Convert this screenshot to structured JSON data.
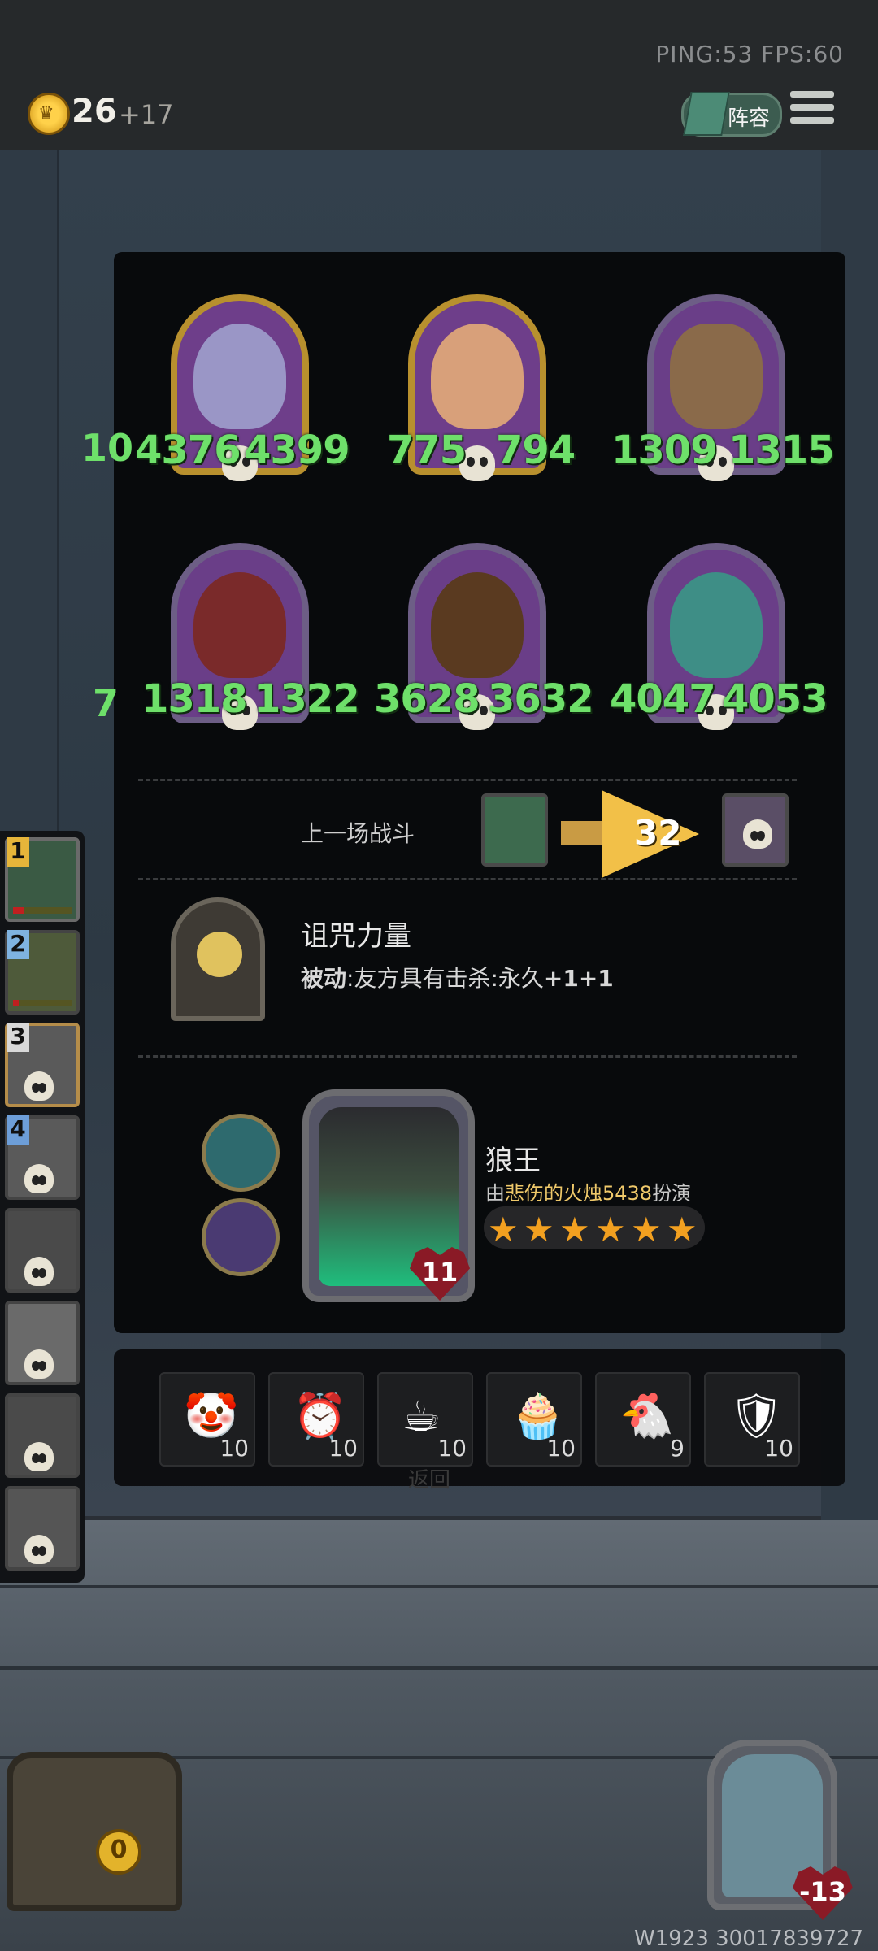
{
  "topbar": {
    "ping_fps": "PING:53   FPS:60",
    "gold": "26",
    "gold_income": "+17",
    "lineup_label": "阵容"
  },
  "board": {
    "row1": [
      {
        "attack": "4376",
        "health": "4399",
        "name": "wizard-portrait"
      },
      {
        "attack": "775",
        "health": "794",
        "name": "cyborg-portrait"
      },
      {
        "attack": "1309",
        "health": "1315",
        "name": "robot-portrait"
      }
    ],
    "row2": [
      {
        "attack": "1318",
        "health": "1322",
        "name": "assassin-portrait"
      },
      {
        "attack": "3628",
        "health": "3632",
        "name": "hooded-portrait"
      },
      {
        "attack": "4047",
        "health": "4053",
        "name": "spirit-portrait"
      }
    ],
    "side_left_1": "10",
    "side_left_2": "7"
  },
  "last_battle": {
    "label": "上一场战斗",
    "damage": "32"
  },
  "curse": {
    "title": "诅咒力量",
    "desc_prefix": "被动",
    "desc_body": ":友方具有击杀:永久",
    "desc_bonus": "+1+1"
  },
  "hero": {
    "name": "狼王",
    "played_prefix": "由",
    "played_by": "悲伤的火烛5438",
    "played_suffix": "扮演",
    "health": "11",
    "stars": 6
  },
  "shop_items": [
    {
      "icon": "clown-icon",
      "glyph": "🤡",
      "count": "10"
    },
    {
      "icon": "alarm-clock-icon",
      "glyph": "⏰",
      "count": "10"
    },
    {
      "icon": "teacup-icon",
      "glyph": "☕",
      "count": "10"
    },
    {
      "icon": "cupcake-icon",
      "glyph": "🧁",
      "count": "10"
    },
    {
      "icon": "chicken-icon",
      "glyph": "🐔",
      "count": "9"
    },
    {
      "icon": "shield-icon",
      "glyph": "🛡",
      "count": "10"
    }
  ],
  "back_label": "返回",
  "left_bar": {
    "slots": [
      {
        "rank": "1",
        "rank_color": "#e6b53a"
      },
      {
        "rank": "2",
        "rank_color": "#7fb3e0"
      },
      {
        "rank": "3",
        "rank_color": "#d8d8d8"
      },
      {
        "rank": "4",
        "rank_color": "#6d9ed8"
      },
      {
        "rank": ""
      },
      {
        "rank": ""
      },
      {
        "rank": ""
      },
      {
        "rank": ""
      }
    ]
  },
  "chest_count": "0",
  "boss_health": "-13",
  "footer_id": "W1923 30017839727",
  "colors": {
    "stat_green": "#6ee06a",
    "accent_gold": "#e6b53a"
  }
}
